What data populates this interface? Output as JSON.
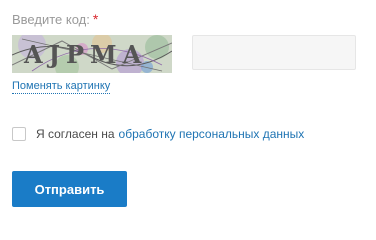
{
  "form": {
    "code_label": "Введите код:",
    "required_mark": "*",
    "captcha_text": "AJPMA",
    "code_value": "",
    "change_image_label": "Поменять картинку",
    "agree_prefix": "Я согласен на",
    "agree_link": "обработку персональных данных",
    "agree_checked": false,
    "submit_label": "Отправить"
  },
  "colors": {
    "accent": "#1a7cc7",
    "link": "#1f74b3",
    "required": "#d8272e"
  }
}
